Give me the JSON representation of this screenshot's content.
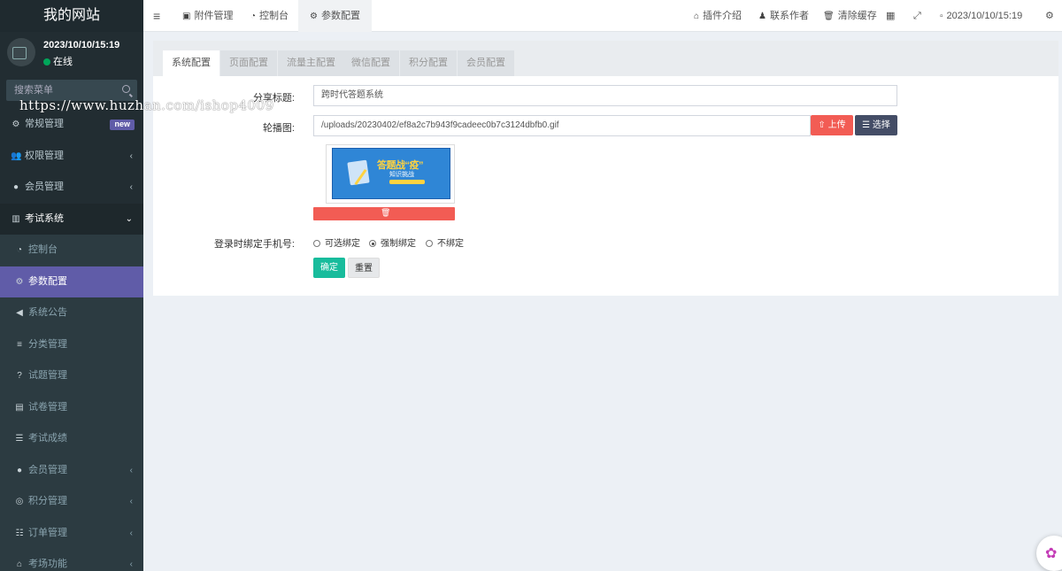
{
  "sidebar": {
    "logo": "我的网站",
    "user": {
      "name": "2023/10/10/15:19",
      "status": "在线"
    },
    "search_placeholder": "搜索菜单",
    "menu": [
      {
        "label": "常规管理",
        "icon": "cogs-icon",
        "badge": "new"
      },
      {
        "label": "权限管理",
        "icon": "users-icon",
        "arrow": "‹"
      },
      {
        "label": "会员管理",
        "icon": "user-circle-icon",
        "arrow": "‹"
      },
      {
        "label": "考试系统",
        "icon": "columns-icon",
        "arrow": "⌄"
      }
    ],
    "submenu": [
      {
        "label": "控制台",
        "icon": "dashboard-icon"
      },
      {
        "label": "参数配置",
        "icon": "cogs-icon",
        "active": true
      },
      {
        "label": "系统公告",
        "icon": "volume-icon"
      },
      {
        "label": "分类管理",
        "icon": "align-left-icon"
      },
      {
        "label": "试题管理",
        "icon": "question-circle-icon"
      },
      {
        "label": "试卷管理",
        "icon": "keyboard-icon"
      },
      {
        "label": "考试成绩",
        "icon": "list-icon"
      },
      {
        "label": "会员管理",
        "icon": "user-circle-icon",
        "arrow": "‹"
      },
      {
        "label": "积分管理",
        "icon": "globe-icon",
        "arrow": "‹"
      },
      {
        "label": "订单管理",
        "icon": "list-ol-icon",
        "arrow": "‹"
      },
      {
        "label": "考场功能",
        "icon": "bank-icon",
        "arrow": "‹"
      }
    ]
  },
  "watermark": "https://www.huzhan.com/ishop4009",
  "topbar": {
    "tabs": [
      {
        "label": "附件管理",
        "icon": "image-icon"
      },
      {
        "label": "控制台",
        "icon": "dashboard-icon"
      },
      {
        "label": "参数配置",
        "icon": "cogs-icon",
        "current": true
      }
    ],
    "right": [
      {
        "label": "插件介绍",
        "icon": "home-icon"
      },
      {
        "label": "联系作者",
        "icon": "qq-icon"
      },
      {
        "label": "清除缓存",
        "icon": "trash-icon"
      }
    ],
    "datetime": "2023/10/10/15:19"
  },
  "config": {
    "tabs": [
      "系统配置",
      "页面配置",
      "流量主配置",
      "微信配置",
      "积分配置",
      "会员配置"
    ],
    "active_tab": "系统配置",
    "share_title": {
      "label": "分享标题:",
      "value": "跨时代答题系统"
    },
    "carousel": {
      "label": "轮播图:",
      "value": "/uploads/20230402/ef8a2c7b943f9cadeec0b7c3124dbfb0.gif",
      "upload_label": "上传",
      "select_label": "选择",
      "preview": {
        "title": "答题战“疫”",
        "subtitle": "知识挑战"
      }
    },
    "bind_phone": {
      "label": "登录时绑定手机号:",
      "options": [
        "可选绑定",
        "强制绑定",
        "不绑定"
      ],
      "selected": "强制绑定"
    },
    "confirm_label": "确定",
    "reset_label": "重置"
  },
  "colors": {
    "sidebar": "#222d32",
    "active": "#605ca8",
    "danger": "#f25c54",
    "primary_dark": "#444d66",
    "success": "#18bc9c"
  }
}
